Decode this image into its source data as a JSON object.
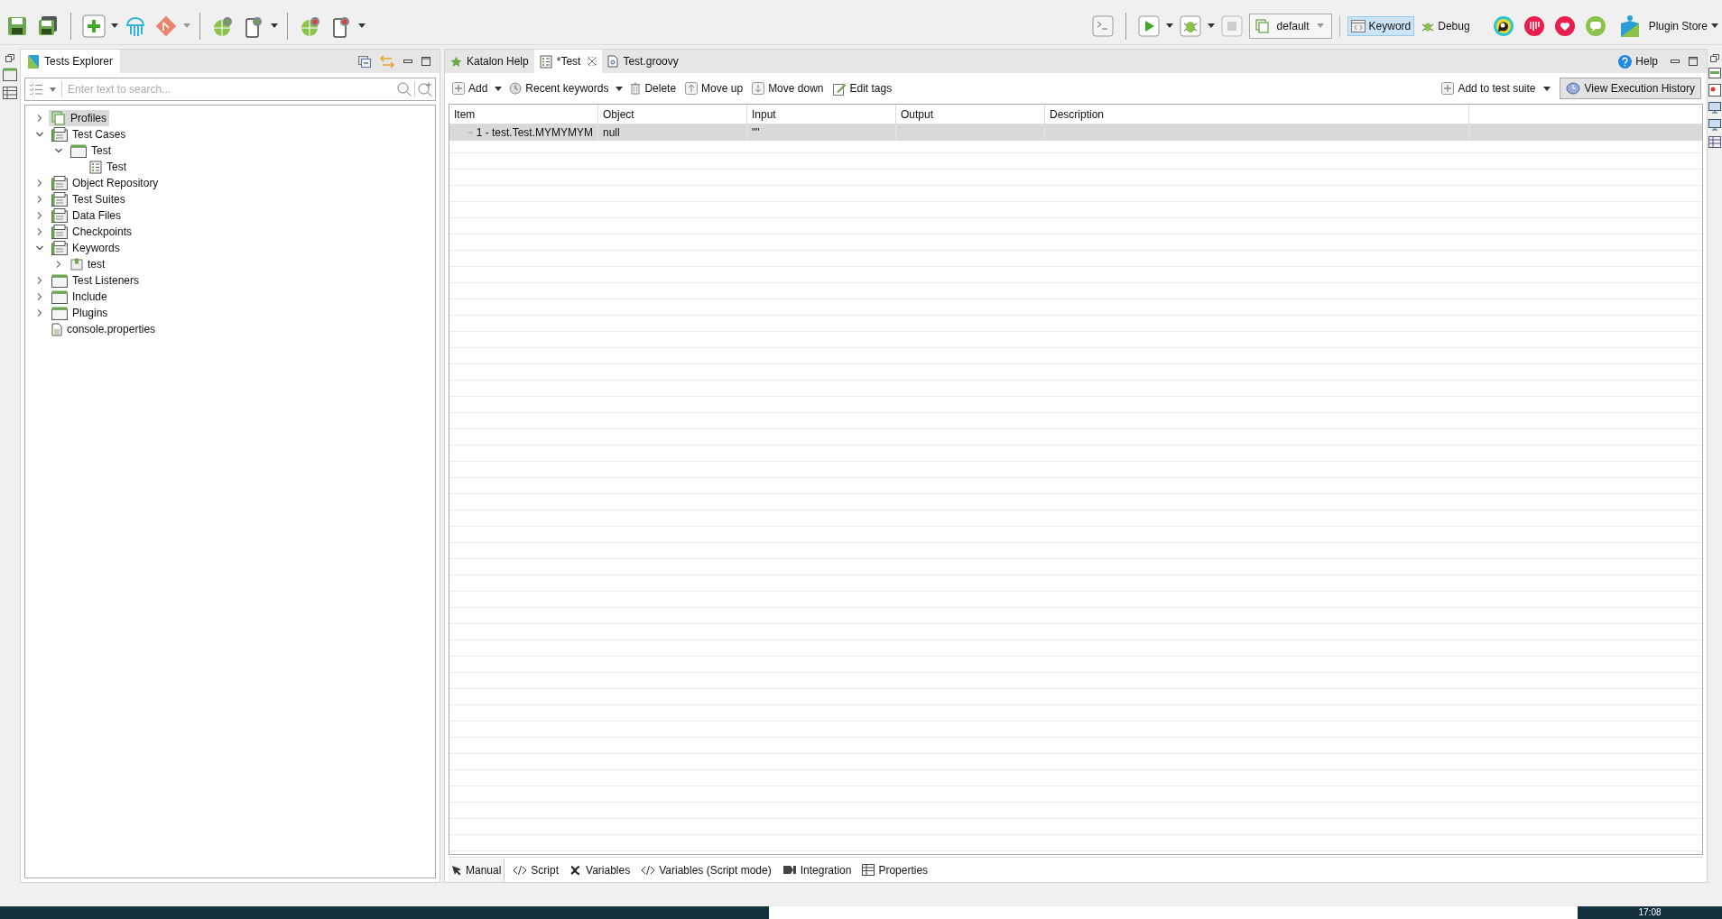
{
  "toolbar": {
    "profile": "default",
    "perspectives": [
      {
        "label": "Keyword",
        "selected": true
      },
      {
        "label": "Debug",
        "selected": false
      }
    ],
    "plugin_store": "Plugin Store"
  },
  "explorer": {
    "title": "Tests Explorer",
    "search": {
      "placeholder": "Enter text to search..."
    },
    "tree": [
      {
        "label": "Profiles",
        "kind": "profiles",
        "expanded": false,
        "selected": true
      },
      {
        "label": "Test Cases",
        "kind": "testcases",
        "expanded": true,
        "selected": false,
        "children": [
          {
            "label": "Test",
            "kind": "folder",
            "expanded": true,
            "selected": false,
            "children": [
              {
                "label": "Test",
                "kind": "testcase",
                "selected": false
              }
            ]
          }
        ]
      },
      {
        "label": "Object Repository",
        "kind": "repo",
        "expanded": false,
        "selected": false
      },
      {
        "label": "Test Suites",
        "kind": "repo",
        "expanded": false,
        "selected": false
      },
      {
        "label": "Data Files",
        "kind": "repo",
        "expanded": false,
        "selected": false
      },
      {
        "label": "Checkpoints",
        "kind": "repo",
        "expanded": false,
        "selected": false
      },
      {
        "label": "Keywords",
        "kind": "repo",
        "expanded": true,
        "selected": false,
        "children": [
          {
            "label": "test",
            "kind": "package",
            "expanded": false,
            "selected": false
          }
        ]
      },
      {
        "label": "Test Listeners",
        "kind": "folder",
        "expanded": false,
        "selected": false
      },
      {
        "label": "Include",
        "kind": "folder",
        "expanded": false,
        "selected": false
      },
      {
        "label": "Plugins",
        "kind": "folder",
        "expanded": false,
        "selected": false
      },
      {
        "label": "console.properties",
        "kind": "file",
        "selected": false
      }
    ]
  },
  "editor_tabs": [
    {
      "label": "Katalon Help",
      "kind": "help",
      "selected": false
    },
    {
      "label": "*Test",
      "kind": "testcase",
      "selected": true
    },
    {
      "label": "Test.groovy",
      "kind": "groovy",
      "selected": false
    }
  ],
  "help": "Help",
  "actions": [
    {
      "label": "Add",
      "kind": "add"
    },
    {
      "label": "Recent keywords",
      "kind": "recent"
    },
    {
      "label": "Delete",
      "kind": "delete"
    },
    {
      "label": "Move up",
      "kind": "up"
    },
    {
      "label": "Move down",
      "kind": "down"
    },
    {
      "label": "Edit tags",
      "kind": "tags"
    }
  ],
  "add_to_suite": "Add to test suite",
  "view_history": "View Execution History",
  "table": {
    "columns": [
      "Item",
      "Object",
      "Input",
      "Output",
      "Description"
    ],
    "rows": [
      {
        "cells": [
          "1 - test.Test.MYMYMYM",
          "null",
          "\"\"",
          "",
          ""
        ],
        "selected": true
      }
    ]
  },
  "bottom_tabs": [
    {
      "label": "Manual",
      "kind": "manual",
      "selected": true
    },
    {
      "label": "Script",
      "kind": "code",
      "selected": false
    },
    {
      "label": "Variables",
      "kind": "var",
      "selected": false
    },
    {
      "label": "Variables (Script mode)",
      "kind": "code",
      "selected": false
    },
    {
      "label": "Integration",
      "kind": "integration",
      "selected": false
    },
    {
      "label": "Properties",
      "kind": "table",
      "selected": false
    }
  ],
  "taskbar": {
    "clock": "17:08"
  }
}
